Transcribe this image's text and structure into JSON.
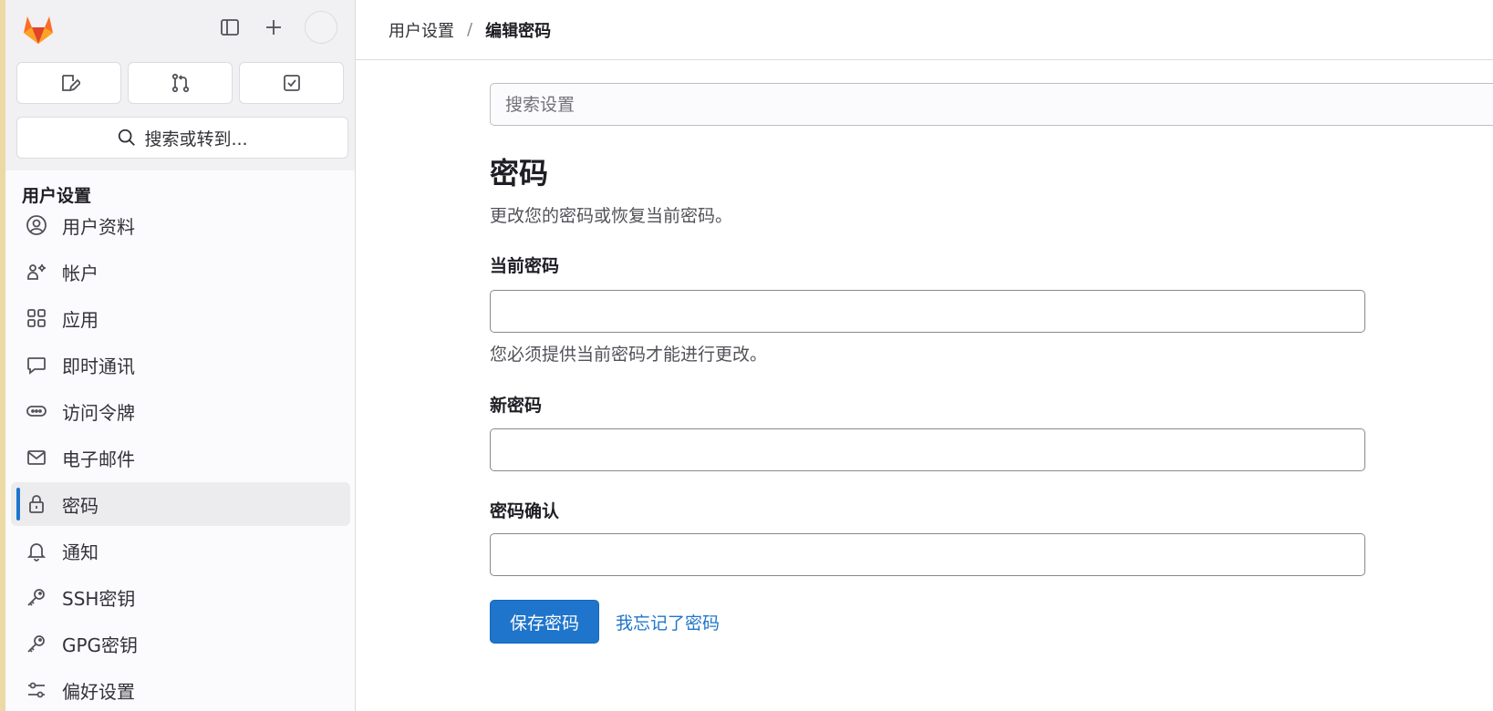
{
  "sidebar": {
    "search_label": "搜索或转到...",
    "section_title": "用户设置",
    "items": [
      {
        "label": "用户资料",
        "icon": "profile-icon"
      },
      {
        "label": "帐户",
        "icon": "account-icon"
      },
      {
        "label": "应用",
        "icon": "applications-icon"
      },
      {
        "label": "即时通讯",
        "icon": "chat-icon"
      },
      {
        "label": "访问令牌",
        "icon": "token-icon"
      },
      {
        "label": "电子邮件",
        "icon": "mail-icon"
      },
      {
        "label": "密码",
        "icon": "lock-icon",
        "active": true
      },
      {
        "label": "通知",
        "icon": "bell-icon"
      },
      {
        "label": "SSH密钥",
        "icon": "key-icon"
      },
      {
        "label": "GPG密钥",
        "icon": "key-icon"
      },
      {
        "label": "偏好设置",
        "icon": "preferences-icon"
      }
    ]
  },
  "breadcrumb": {
    "parent": "用户设置",
    "separator": "/",
    "current": "编辑密码"
  },
  "main": {
    "search_placeholder": "搜索设置",
    "title": "密码",
    "description": "更改您的密码或恢复当前密码。",
    "current_password_label": "当前密码",
    "current_password_help": "您必须提供当前密码才能进行更改。",
    "new_password_label": "新密码",
    "confirm_password_label": "密码确认",
    "save_button": "保存密码",
    "forgot_link": "我忘记了密码"
  },
  "colors": {
    "primary": "#1f75cb",
    "sidebar_bg": "#fbfafd",
    "active_item_bg": "#ececef"
  }
}
